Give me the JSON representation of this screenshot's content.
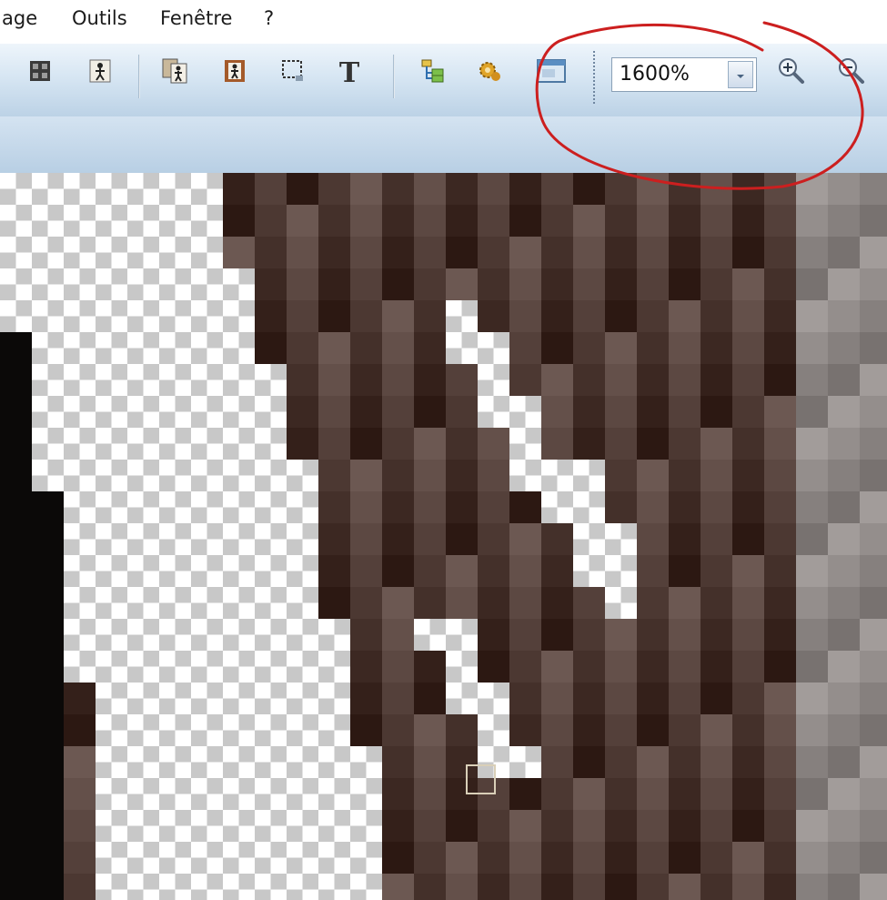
{
  "menu": {
    "items": [
      {
        "label": "age"
      },
      {
        "label": "Outils"
      },
      {
        "label": "Fenêtre"
      },
      {
        "label": "?"
      }
    ]
  },
  "toolbar": {
    "zoom_value": "1600%",
    "text_tool_label": "T"
  },
  "icons": [
    "grid-icon",
    "person-icon",
    "copy-person-icon",
    "framed-person-icon",
    "selection-icon",
    "text-icon",
    "tree-icon",
    "gear-icon",
    "window-icon",
    "chevron-down-icon",
    "zoom-in-icon",
    "zoom-out-icon"
  ],
  "colors": {
    "toolbar_top": "#eef5fb",
    "toolbar_bottom": "#bcd2e6",
    "annotation": "#cc1f1f",
    "pixel_cursor": "#d9cfb8"
  }
}
